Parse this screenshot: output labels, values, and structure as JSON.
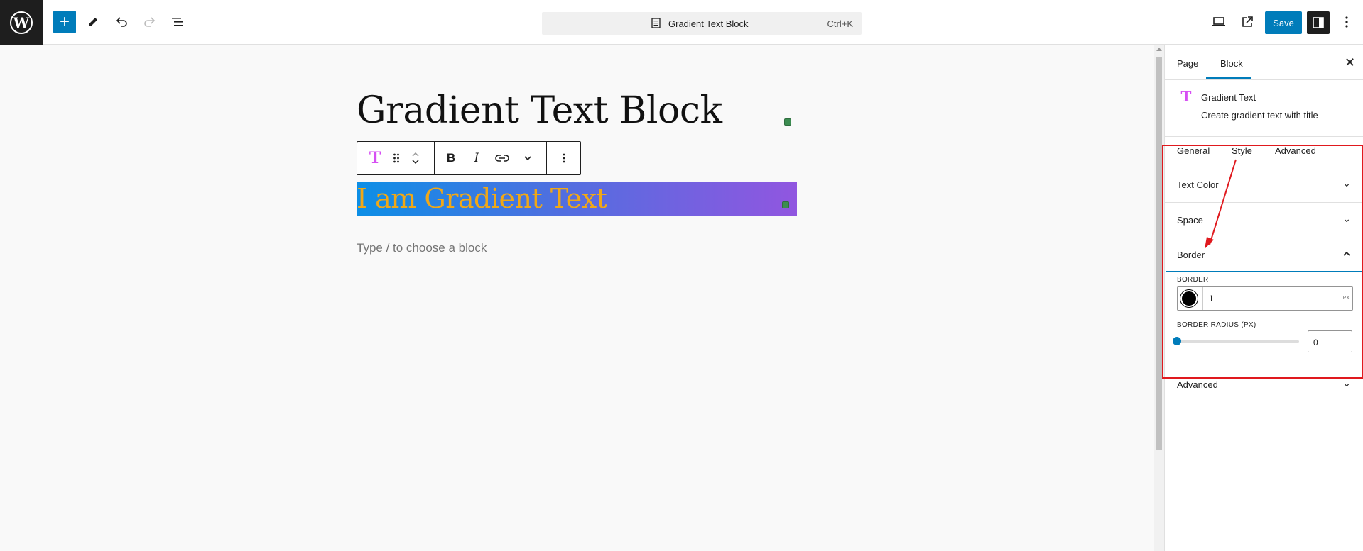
{
  "topbar": {
    "document_title": "Gradient Text Block",
    "shortcut": "Ctrl+K",
    "save_label": "Save"
  },
  "editor": {
    "page_title": "Gradient Text Block",
    "gradient_text": "I am Gradient Text",
    "placeholder": "Type / to choose a block",
    "gradient_colors": [
      "#0c8fe6",
      "#4f6fe0",
      "#9156e0"
    ],
    "text_color": "#f0a817"
  },
  "sidebar": {
    "tabs": [
      "Page",
      "Block"
    ],
    "active_tab": "Block",
    "block_icon_glyph": "T",
    "block_name": "Gradient Text",
    "block_description": "Create gradient text with title",
    "style_tabs": [
      "General",
      "Style",
      "Advanced"
    ],
    "panels": {
      "text_color": "Text Color",
      "space": "Space",
      "border": "Border",
      "advanced": "Advanced"
    },
    "border_label": "BORDER",
    "border_width": "1",
    "border_unit": "PX",
    "border_radius_label": "BORDER RADIUS (PX)",
    "border_radius_value": "0"
  },
  "colors": {
    "accent": "#007cba",
    "annotation": "#e0191e"
  }
}
